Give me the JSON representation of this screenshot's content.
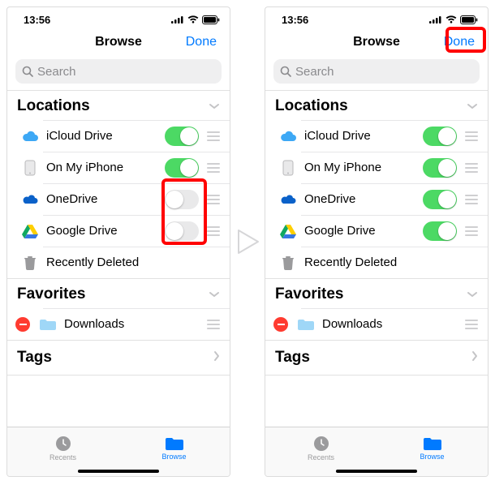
{
  "screens": {
    "left": {
      "status": {
        "time": "13:56"
      },
      "nav": {
        "title": "Browse",
        "done": "Done"
      },
      "search": {
        "placeholder": "Search"
      },
      "sections": {
        "locations": {
          "title": "Locations",
          "items": [
            {
              "label": "iCloud Drive",
              "toggle": true
            },
            {
              "label": "On My iPhone",
              "toggle": true
            },
            {
              "label": "OneDrive",
              "toggle": false
            },
            {
              "label": "Google Drive",
              "toggle": false
            },
            {
              "label": "Recently Deleted",
              "toggle": null
            }
          ]
        },
        "favorites": {
          "title": "Favorites",
          "items": [
            {
              "label": "Downloads"
            }
          ]
        },
        "tags": {
          "title": "Tags"
        }
      },
      "tabs": {
        "recents": "Recents",
        "browse": "Browse"
      },
      "highlight": "toggles"
    },
    "right": {
      "status": {
        "time": "13:56"
      },
      "nav": {
        "title": "Browse",
        "done": "Done"
      },
      "search": {
        "placeholder": "Search"
      },
      "sections": {
        "locations": {
          "title": "Locations",
          "items": [
            {
              "label": "iCloud Drive",
              "toggle": true
            },
            {
              "label": "On My iPhone",
              "toggle": true
            },
            {
              "label": "OneDrive",
              "toggle": true
            },
            {
              "label": "Google Drive",
              "toggle": true
            },
            {
              "label": "Recently Deleted",
              "toggle": null
            }
          ]
        },
        "favorites": {
          "title": "Favorites",
          "items": [
            {
              "label": "Downloads"
            }
          ]
        },
        "tags": {
          "title": "Tags"
        }
      },
      "tabs": {
        "recents": "Recents",
        "browse": "Browse"
      },
      "highlight": "done"
    }
  }
}
